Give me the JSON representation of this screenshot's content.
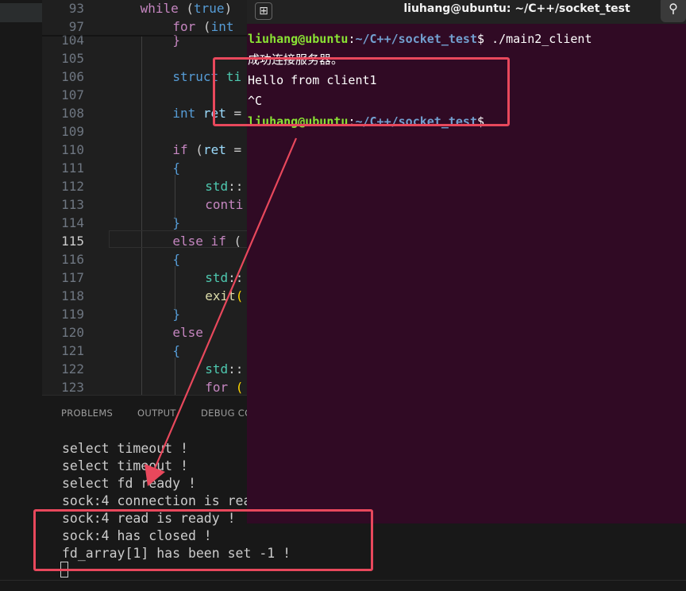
{
  "editor": {
    "lines": [
      {
        "num": "93",
        "tokens": [
          [
            "kw",
            "while "
          ],
          [
            "plain",
            "("
          ],
          [
            "ty",
            "true"
          ],
          [
            "plain",
            ")"
          ]
        ]
      },
      {
        "num": "97",
        "tokens": [
          [
            "kw",
            "for "
          ],
          [
            "plain",
            "("
          ],
          [
            "ty",
            "int"
          ]
        ]
      },
      {
        "num": "104",
        "tokens": [
          [
            "kw",
            "}"
          ]
        ]
      },
      {
        "num": "105",
        "tokens": []
      },
      {
        "num": "106",
        "tokens": [
          [
            "ty",
            "struct "
          ],
          [
            "ns",
            "ti"
          ]
        ]
      },
      {
        "num": "107",
        "tokens": []
      },
      {
        "num": "108",
        "tokens": [
          [
            "ty",
            "int "
          ],
          [
            "id",
            "ret"
          ],
          [
            "plain",
            " ="
          ]
        ]
      },
      {
        "num": "109",
        "tokens": []
      },
      {
        "num": "110",
        "tokens": [
          [
            "kw",
            "if "
          ],
          [
            "plain",
            "("
          ],
          [
            "id",
            "ret"
          ],
          [
            "plain",
            " ="
          ]
        ]
      },
      {
        "num": "111",
        "tokens": [
          [
            "ty",
            "{"
          ]
        ]
      },
      {
        "num": "112",
        "tokens": [
          [
            "ns",
            "std"
          ],
          [
            "plain",
            "::"
          ]
        ]
      },
      {
        "num": "113",
        "tokens": [
          [
            "kw",
            "conti"
          ]
        ]
      },
      {
        "num": "114",
        "tokens": [
          [
            "ty",
            "}"
          ]
        ]
      },
      {
        "num": "115",
        "tokens": [
          [
            "kw",
            "else if "
          ],
          [
            "plain",
            "("
          ]
        ]
      },
      {
        "num": "116",
        "tokens": [
          [
            "ty",
            "{"
          ]
        ]
      },
      {
        "num": "117",
        "tokens": [
          [
            "ns",
            "std"
          ],
          [
            "plain",
            "::"
          ]
        ]
      },
      {
        "num": "118",
        "tokens": [
          [
            "fn",
            "exit"
          ],
          [
            "par",
            "("
          ]
        ]
      },
      {
        "num": "119",
        "tokens": [
          [
            "ty",
            "}"
          ]
        ]
      },
      {
        "num": "120",
        "tokens": [
          [
            "kw",
            "else"
          ]
        ]
      },
      {
        "num": "121",
        "tokens": [
          [
            "ty",
            "{"
          ]
        ]
      },
      {
        "num": "122",
        "tokens": [
          [
            "ns",
            "std"
          ],
          [
            "plain",
            "::"
          ]
        ]
      },
      {
        "num": "123",
        "tokens": [
          [
            "kw",
            "for "
          ],
          [
            "par",
            "("
          ]
        ]
      }
    ],
    "active_line": "115"
  },
  "panel": {
    "tabs": [
      "PROBLEMS",
      "OUTPUT",
      "DEBUG CO"
    ],
    "output_lines": [
      "select timeout !",
      "select timeout !",
      "select fd ready !",
      "sock:4 connection is rea",
      "sock:4 read is ready !",
      "sock:4 has closed !",
      "fd_array[1] has been set -1 !"
    ]
  },
  "terminal": {
    "title": "liuhang@ubuntu: ~/C++/socket_test",
    "new_tab_glyph": "⊞",
    "search_glyph": "⚲",
    "prompt_user": "liuhang@ubuntu",
    "prompt_path": "~/C++/socket_test",
    "command": "./main2_client",
    "lines": [
      "成功连接服务器。",
      "Hello from client1",
      "^C"
    ]
  },
  "colors": {
    "terminal_bg": "#300a24",
    "highlight": "#e8485c",
    "prompt_user": "#8ae234",
    "prompt_path": "#729fcf"
  }
}
